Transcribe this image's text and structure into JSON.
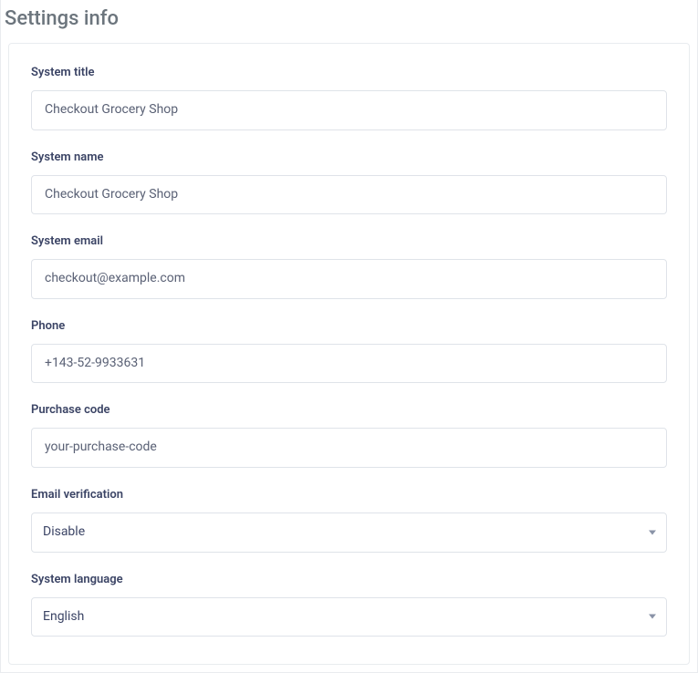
{
  "page": {
    "title": "Settings info"
  },
  "form": {
    "system_title": {
      "label": "System title",
      "value": "Checkout Grocery Shop"
    },
    "system_name": {
      "label": "System name",
      "value": "Checkout Grocery Shop"
    },
    "system_email": {
      "label": "System email",
      "value": "checkout@example.com"
    },
    "phone": {
      "label": "Phone",
      "value": "+143-52-9933631"
    },
    "purchase_code": {
      "label": "Purchase code",
      "value": "your-purchase-code"
    },
    "email_verification": {
      "label": "Email verification",
      "selected": "Disable"
    },
    "system_language": {
      "label": "System language",
      "selected": "English"
    }
  }
}
